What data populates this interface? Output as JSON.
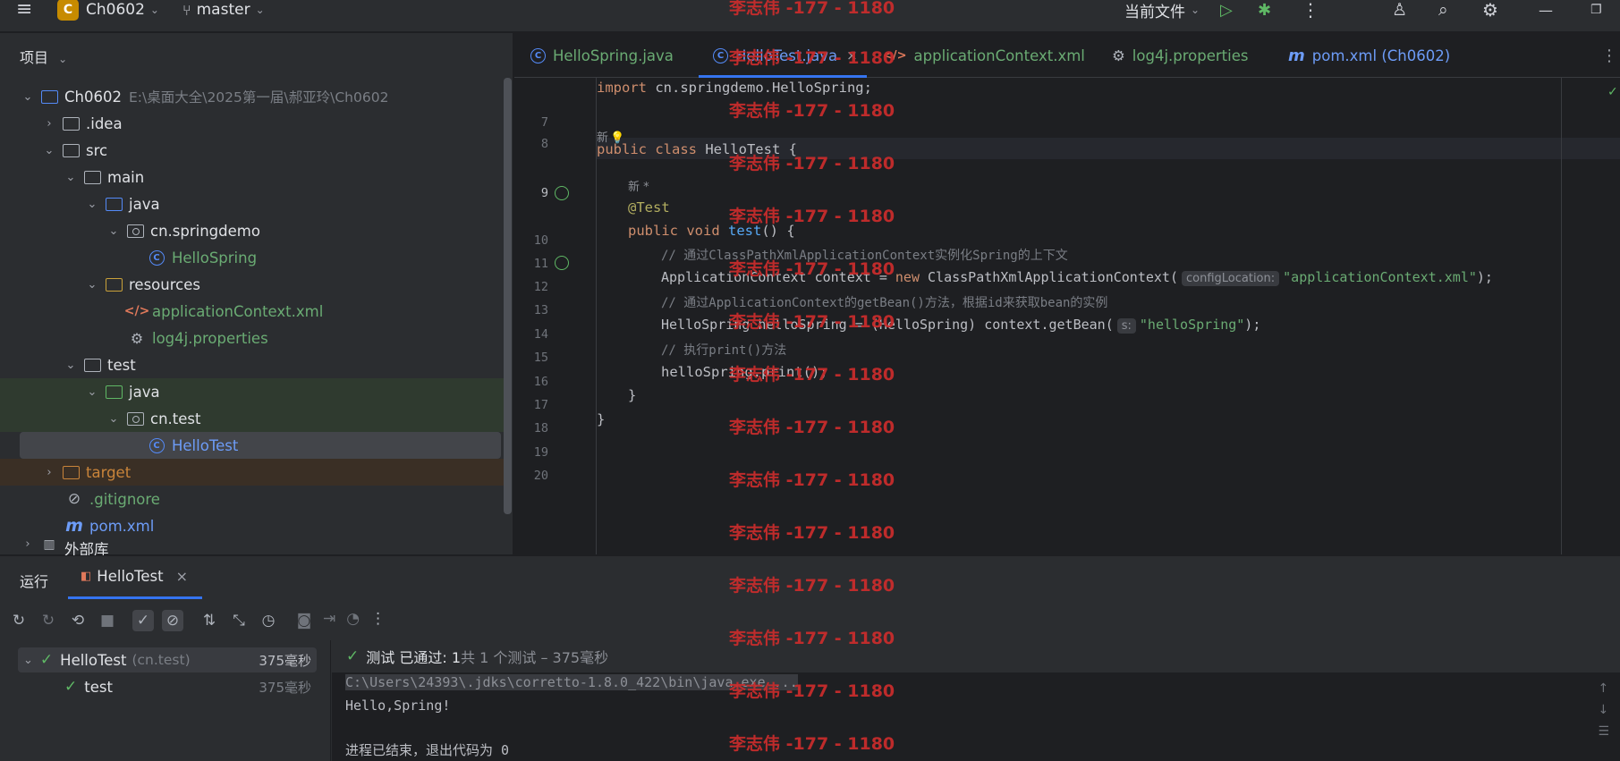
{
  "titlebar": {
    "project_badge": "C",
    "project_name": "Ch0602",
    "branch": "master",
    "current_file": "当前文件"
  },
  "project": {
    "header": "项目",
    "tree": [
      {
        "label": "Ch0602",
        "detail": "E:\\桌面大全\\2025第一届\\郝亚玲\\Ch0602"
      },
      {
        "label": ".idea"
      },
      {
        "label": "src"
      },
      {
        "label": "main"
      },
      {
        "label": "java"
      },
      {
        "label": "cn.springdemo"
      },
      {
        "label": "HelloSpring"
      },
      {
        "label": "resources"
      },
      {
        "label": "applicationContext.xml"
      },
      {
        "label": "log4j.properties"
      },
      {
        "label": "test"
      },
      {
        "label": "java"
      },
      {
        "label": "cn.test"
      },
      {
        "label": "HelloTest"
      },
      {
        "label": "target"
      },
      {
        "label": ".gitignore"
      },
      {
        "label": "pom.xml"
      },
      {
        "label": "外部库"
      }
    ]
  },
  "editor": {
    "tabs": [
      {
        "label": "HelloSpring.java"
      },
      {
        "label": "HelloTest.java"
      },
      {
        "label": "applicationContext.xml"
      },
      {
        "label": "log4j.properties"
      },
      {
        "label": "pom.xml (Ch0602)"
      }
    ],
    "lines": {
      "n7": "7",
      "n8": "8",
      "n9": "9",
      "n10": "10",
      "n11": "11",
      "n12": "12",
      "n13": "13",
      "n14": "14",
      "n15": "15",
      "n16": "16",
      "n17": "17",
      "n18": "18",
      "n19": "19",
      "n20": "20"
    },
    "code": {
      "l7_kw": "import",
      "l7_rest": " cn.springdemo.HelloSpring;",
      "new_hint": "新",
      "l9_kw": "public class",
      "l9_rest": " HelloTest {",
      "new_hint2": "新 *",
      "l10": "@Test",
      "l11_kw": "public void",
      "l11_fn": "test",
      "l11_rest": "() {",
      "l12": "// 通过ClassPathXmlApplicationContext实例化Spring的上下文",
      "l13_a": "ApplicationContext context = ",
      "l13_kw": "new",
      "l13_b": " ClassPathXmlApplicationContext(",
      "l13_hint": "configLocation:",
      "l13_str": "\"applicationContext.xml\"",
      "l13_end": ");",
      "l14": "// 通过ApplicationContext的getBean()方法，根据id来获取bean的实例",
      "l15_a": "HelloSpring helloSpring = (HelloSpring) context.getBean(",
      "l15_hint": "s:",
      "l15_str": "\"helloSpring\"",
      "l15_end": ");",
      "l16": "// 执行print()方法",
      "l17": "helloSpring.print();",
      "l18": "}",
      "l19": "}"
    }
  },
  "run": {
    "label": "运行",
    "tab": "HelloTest",
    "tree": [
      {
        "label": "HelloTest",
        "detail": "(cn.test)",
        "time": "375毫秒"
      },
      {
        "label": "test",
        "time": "375毫秒"
      }
    ],
    "status_a": "测试 已通过: 1",
    "status_b": "共 1 个测试 – 375毫秒",
    "console": [
      "C:\\Users\\24393\\.jdks\\corretto-1.8.0_422\\bin\\java.exe ...",
      "Hello,Spring!",
      "",
      "进程已结束，退出代码为 0"
    ]
  },
  "watermark": "李志伟 -177 - 1180",
  "colors": {
    "accent": "#3574f0",
    "success": "#5fb865",
    "watermark": "#c72c2c"
  }
}
